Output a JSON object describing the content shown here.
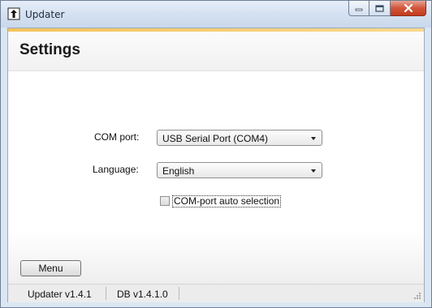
{
  "window": {
    "title": "Updater",
    "icons": {
      "app": "updater-app-icon",
      "minimize": "minimize-icon",
      "maximize": "maximize-icon",
      "close": "close-icon"
    },
    "colors": {
      "accent_bar": "#f3c35c",
      "close_button": "#c23a1c",
      "frame": "#dbe6f3"
    }
  },
  "page": {
    "title": "Settings"
  },
  "form": {
    "com_port": {
      "label": "COM port:",
      "value": "USB Serial Port (COM4)"
    },
    "language": {
      "label": "Language:",
      "value": "English"
    },
    "auto_select": {
      "label": "COM-port auto selection",
      "checked": false
    }
  },
  "footer": {
    "menu_label": "Menu",
    "status": {
      "updater_version": "Updater v1.4.1",
      "db_version": "DB v1.4.1.0"
    }
  }
}
